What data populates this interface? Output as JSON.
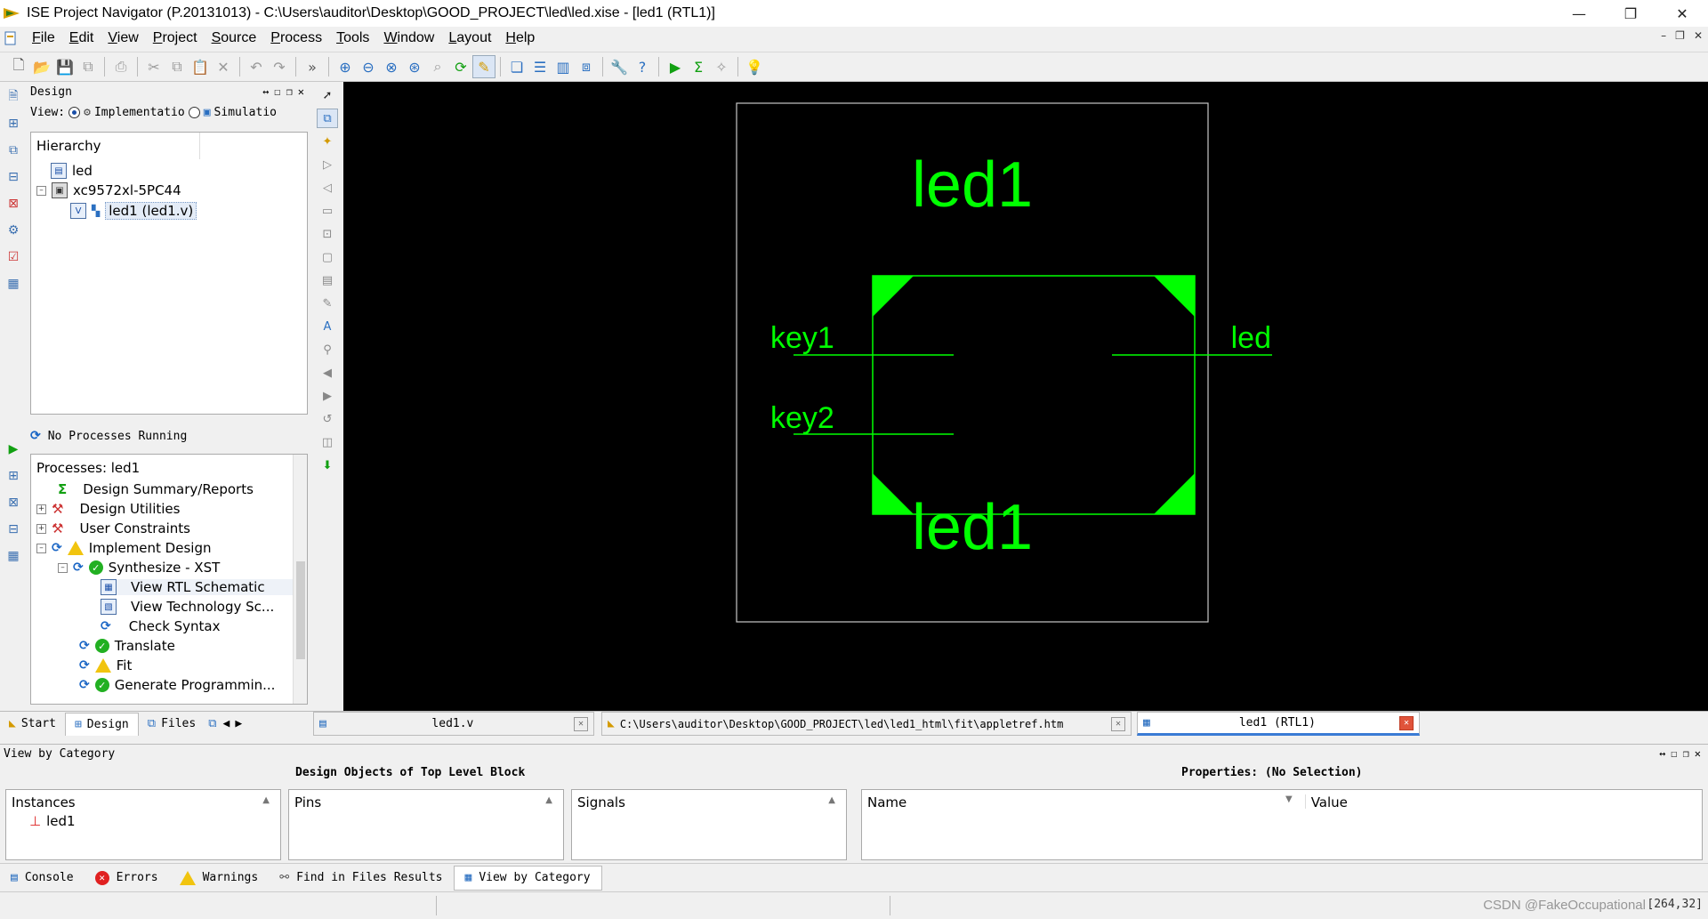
{
  "window": {
    "title": "ISE Project Navigator (P.20131013) - C:\\Users\\auditor\\Desktop\\GOOD_PROJECT\\led\\led.xise - [led1 (RTL1)]",
    "minimize": "—",
    "restore": "❐",
    "close": "✕"
  },
  "menu": [
    "File",
    "Edit",
    "View",
    "Project",
    "Source",
    "Process",
    "Tools",
    "Window",
    "Layout",
    "Help"
  ],
  "design_panel": {
    "header": "Design",
    "view_label": "View:",
    "view_implementation": "Implementatio",
    "view_simulation": "Simulatio",
    "hierarchy_header": "Hierarchy",
    "tree": [
      {
        "label": "led"
      },
      {
        "label": "xc9572xl-5PC44"
      },
      {
        "label": "led1 (led1.v)"
      }
    ],
    "process_status": "No Processes Running",
    "processes_header": "Processes: led1",
    "processes": [
      {
        "label": "Design Summary/Reports"
      },
      {
        "label": "Design Utilities"
      },
      {
        "label": "User Constraints"
      },
      {
        "label": "Implement Design"
      },
      {
        "label": "Synthesize - XST"
      },
      {
        "label": "View RTL Schematic"
      },
      {
        "label": "View Technology Sc..."
      },
      {
        "label": "Check Syntax"
      },
      {
        "label": "Translate"
      },
      {
        "label": "Fit"
      },
      {
        "label": "Generate Programmin..."
      }
    ]
  },
  "schematic": {
    "top_label": "led1",
    "bottom_label": "led1",
    "inputs": [
      "key1",
      "key2"
    ],
    "outputs": [
      "led"
    ],
    "color": "#00ff00"
  },
  "left_tabs": [
    "Start",
    "Design",
    "Files"
  ],
  "editor_tabs": [
    {
      "label": "led1.v"
    },
    {
      "label": "C:\\Users\\auditor\\Desktop\\GOOD_PROJECT\\led\\led1_html\\fit\\appletref.htm"
    },
    {
      "label": "led1 (RTL1)"
    }
  ],
  "bottom_panel": {
    "header": "View by Category",
    "objects_title": "Design Objects of Top Level Block",
    "properties_title": "Properties: (No Selection)",
    "instances_header": "Instances",
    "instances": [
      "led1"
    ],
    "pins_header": "Pins",
    "signals_header": "Signals",
    "name_header": "Name",
    "value_header": "Value"
  },
  "bottom_tabs": [
    "Console",
    "Errors",
    "Warnings",
    "Find in Files Results",
    "View by Category"
  ],
  "status": {
    "coords": "[264,32]",
    "watermark": "CSDN @FakeOccupational"
  }
}
